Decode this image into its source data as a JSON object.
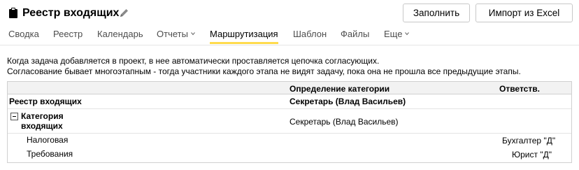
{
  "header": {
    "title": "Реестр входящих",
    "icons": {
      "app": "clipboard-icon",
      "edit": "pencil-icon"
    },
    "buttons": {
      "fill": "Заполнить",
      "import": "Импорт из Excel"
    }
  },
  "tabs": [
    {
      "label": "Сводка"
    },
    {
      "label": "Реестр"
    },
    {
      "label": "Календарь"
    },
    {
      "label": "Отчеты",
      "dropdown": true
    },
    {
      "label": "Маршрутизация",
      "active": true
    },
    {
      "label": "Шаблон"
    },
    {
      "label": "Файлы"
    },
    {
      "label": "Еще",
      "dropdown": true
    }
  ],
  "info": {
    "line1": "Когда задача добавляется в проект, в нее автоматически проставляется цепочка согласующих.",
    "line2": "Согласование бывает многоэтапным - тогда участники каждого этапа не видят задачу, пока она не прошла все предыдущие этапы."
  },
  "table": {
    "headers": {
      "category_definition": "Определение категории",
      "responsible": "Ответств."
    },
    "root": {
      "name": "Реестр входящих",
      "category_definition": "Секретарь (Влад Васильев)"
    },
    "group": {
      "name_line1": "Категория",
      "name_line2": "входящих",
      "category_definition": "Секретарь (Влад Васильев)"
    },
    "children": [
      {
        "name": "Налоговая",
        "responsible": "Бухгалтер \"Д\""
      },
      {
        "name": "Требования",
        "responsible": "Юрист \"Д\""
      }
    ]
  },
  "colors": {
    "accent": "#ffdb4d",
    "border": "#d0d0d0"
  }
}
